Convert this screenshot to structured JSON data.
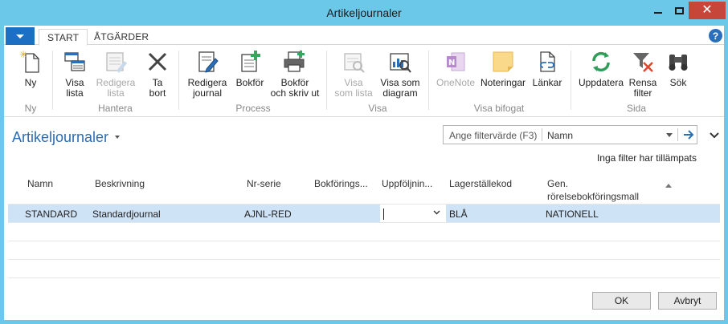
{
  "window": {
    "title": "Artikeljournaler",
    "minimize_glyph": "—",
    "close_glyph": "✕"
  },
  "tabs": [
    {
      "label": "START"
    },
    {
      "label": "ÅTGÄRDER"
    }
  ],
  "help_label": "?",
  "ribbon": {
    "buttons": [
      {
        "label": "Ny",
        "icon": "new-star-icon",
        "enabled": true
      },
      {
        "label": "Visa\nlista",
        "icon": "list-view-icon",
        "enabled": true
      },
      {
        "label": "Redigera\nlista",
        "icon": "edit-list-icon",
        "enabled": false
      },
      {
        "label": "Ta\nbort",
        "icon": "delete-x-icon",
        "enabled": true
      },
      {
        "label": "Redigera\njournal",
        "icon": "edit-journal-icon",
        "enabled": true
      },
      {
        "label": "Bokför",
        "icon": "post-icon",
        "enabled": true
      },
      {
        "label": "Bokför\noch skriv ut",
        "icon": "post-print-icon",
        "enabled": true
      },
      {
        "label": "Visa\nsom lista",
        "icon": "view-list-icon",
        "enabled": false
      },
      {
        "label": "Visa som\ndiagram",
        "icon": "view-chart-icon",
        "enabled": true
      },
      {
        "label": "OneNote",
        "icon": "onenote-icon",
        "enabled": false
      },
      {
        "label": "Noteringar",
        "icon": "notes-icon",
        "enabled": true
      },
      {
        "label": "Länkar",
        "icon": "links-icon",
        "enabled": true
      },
      {
        "label": "Uppdatera",
        "icon": "refresh-icon",
        "enabled": true
      },
      {
        "label": "Rensa\nfilter",
        "icon": "clear-filter-icon",
        "enabled": true
      },
      {
        "label": "Sök",
        "icon": "search-binoculars-icon",
        "enabled": true
      }
    ],
    "groups": [
      {
        "label": "Ny"
      },
      {
        "label": "Hantera"
      },
      {
        "label": "Process"
      },
      {
        "label": "Visa"
      },
      {
        "label": "Visa bifogat"
      },
      {
        "label": "Sida"
      }
    ]
  },
  "page": {
    "title": "Artikeljournaler",
    "filter_placeholder": "Ange filtervärde (F3)",
    "filter_field": "Namn",
    "no_filter_text": "Inga filter har tillämpats"
  },
  "grid": {
    "columns": [
      "Namn",
      "Beskrivning",
      "Nr-serie",
      "Bokförings...",
      "Uppföljnin...",
      "Lagerställekod",
      "Gen.\nrörelsebokföringsmall"
    ],
    "rows": [
      [
        "STANDARD",
        "Standardjournal",
        "AJNL-RED",
        "",
        "",
        "BLÅ",
        "NATIONELL"
      ]
    ],
    "empty_rows": 4
  },
  "buttons": {
    "ok": "OK",
    "cancel": "Avbryt"
  },
  "colors": {
    "window_frame": "#6cc8e8",
    "accent": "#2b6cb0",
    "selected_row": "#cfe3f6",
    "close_button": "#c7463a"
  }
}
